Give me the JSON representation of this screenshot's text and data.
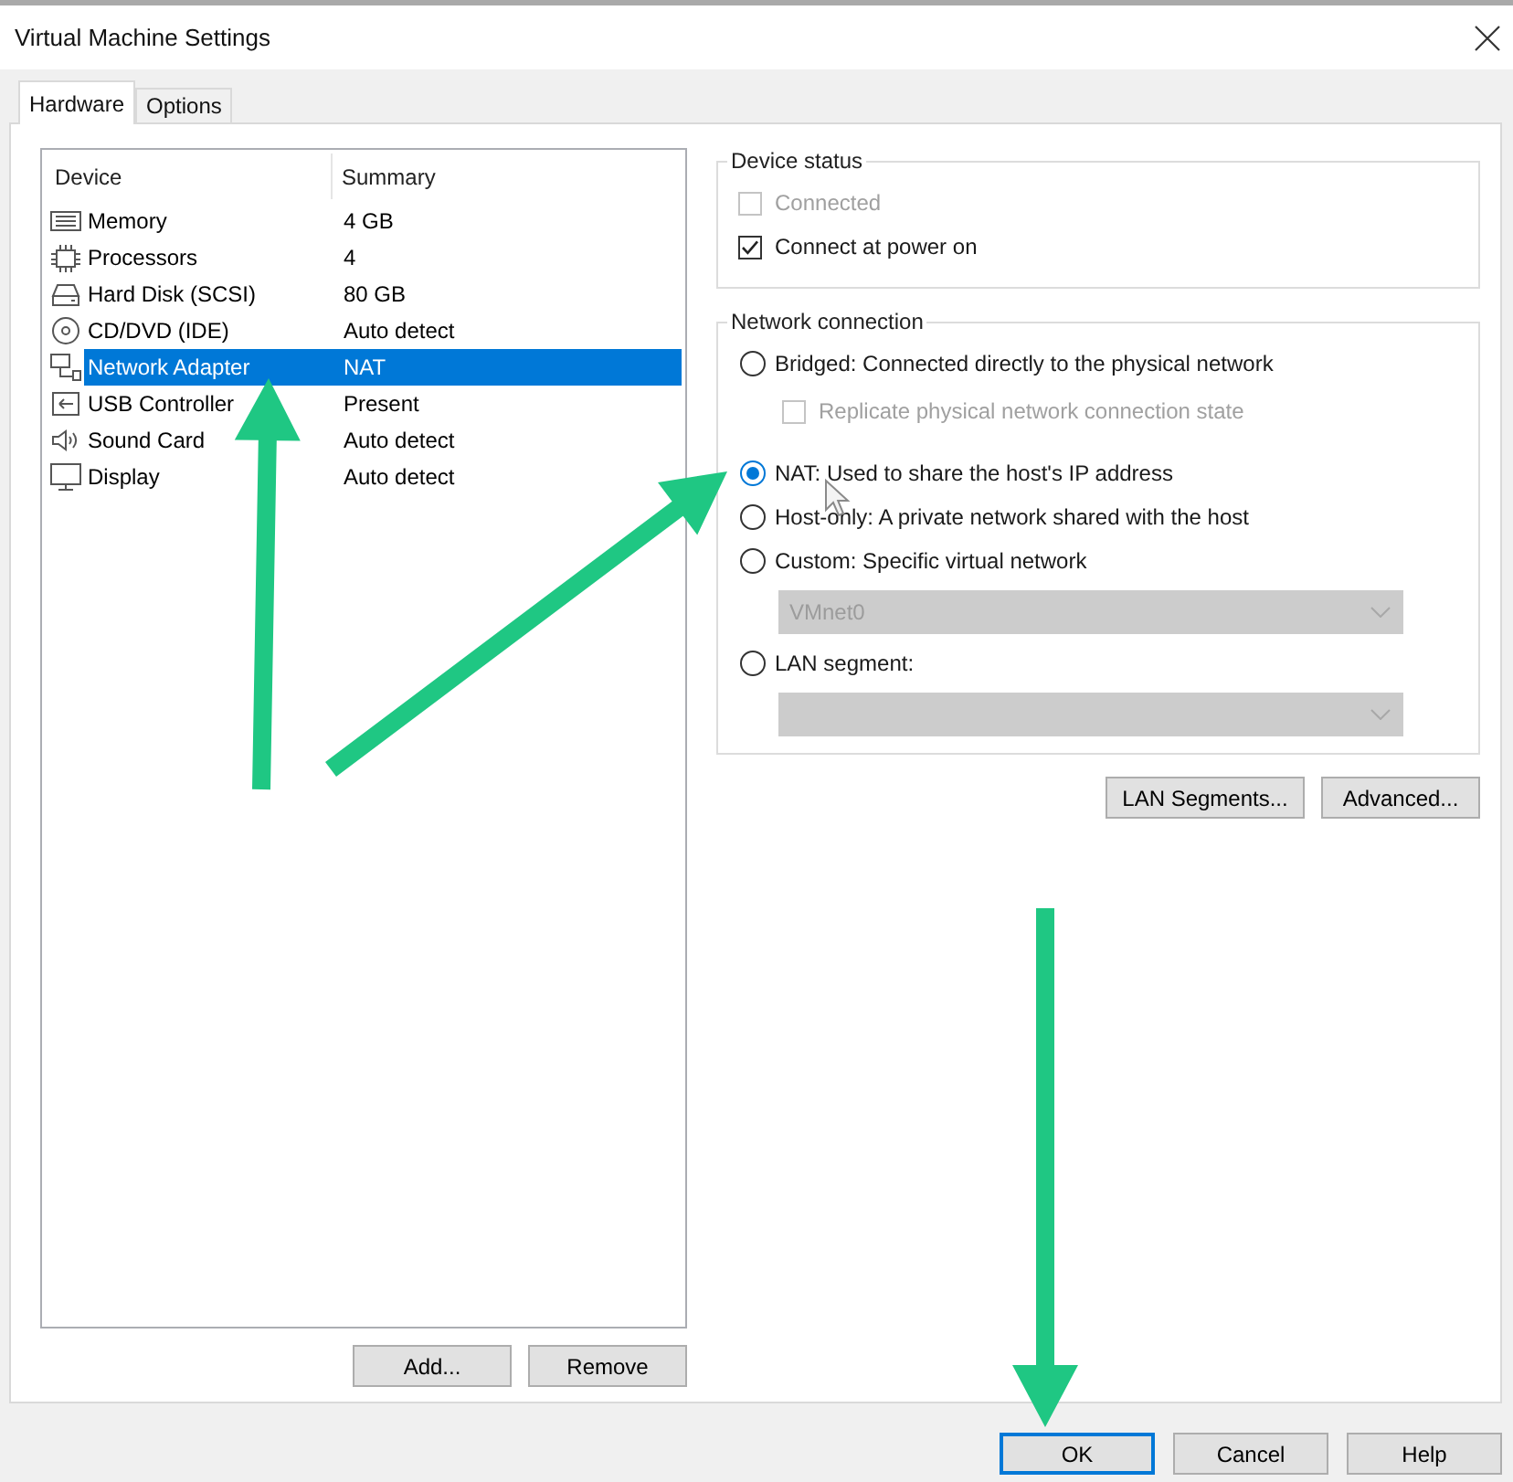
{
  "window": {
    "title": "Virtual Machine Settings"
  },
  "tabs": [
    {
      "label": "Hardware",
      "selected": true
    },
    {
      "label": "Options",
      "selected": false
    }
  ],
  "device_list": {
    "columns": [
      "Device",
      "Summary"
    ],
    "rows": [
      {
        "kind": "memory",
        "device": "Memory",
        "summary": "4 GB",
        "selected": false
      },
      {
        "kind": "processor",
        "device": "Processors",
        "summary": "4",
        "selected": false
      },
      {
        "kind": "hard_disk",
        "device": "Hard Disk (SCSI)",
        "summary": "80 GB",
        "selected": false
      },
      {
        "kind": "cd_dvd",
        "device": "CD/DVD (IDE)",
        "summary": "Auto detect",
        "selected": false
      },
      {
        "kind": "network",
        "device": "Network Adapter",
        "summary": "NAT",
        "selected": true
      },
      {
        "kind": "usb",
        "device": "USB Controller",
        "summary": "Present",
        "selected": false
      },
      {
        "kind": "sound",
        "device": "Sound Card",
        "summary": "Auto detect",
        "selected": false
      },
      {
        "kind": "display",
        "device": "Display",
        "summary": "Auto detect",
        "selected": false
      }
    ]
  },
  "device_buttons": [
    "Add...",
    "Remove"
  ],
  "device_status": {
    "title": "Device status",
    "options": [
      {
        "label": "Connected",
        "checked": false,
        "disabled": true
      },
      {
        "label": "Connect at power on",
        "checked": true,
        "disabled": false
      }
    ]
  },
  "network_connection": {
    "title": "Network connection",
    "items": [
      {
        "kind": "radio",
        "label": "Bridged: Connected directly to the physical network",
        "selected": false,
        "disabled": false
      },
      {
        "kind": "checkbox",
        "label": "Replicate physical network connection state",
        "checked": false,
        "disabled": true
      },
      {
        "kind": "radio",
        "label": "NAT: Used to share the host's IP address",
        "selected": true,
        "disabled": false
      },
      {
        "kind": "radio",
        "label": "Host-only: A private network shared with the host",
        "selected": false,
        "disabled": false
      },
      {
        "kind": "radio",
        "label": "Custom: Specific virtual network",
        "selected": false,
        "disabled": false
      },
      {
        "kind": "dropdown",
        "value": "VMnet0",
        "disabled": true
      },
      {
        "kind": "radio",
        "label": "LAN segment:",
        "selected": false,
        "disabled": false
      },
      {
        "kind": "dropdown",
        "disabled": true
      }
    ]
  },
  "network_buttons": [
    "LAN Segments...",
    "Advanced..."
  ],
  "dialog_buttons": [
    {
      "label": "OK",
      "default": true
    },
    {
      "label": "Cancel",
      "default": false
    },
    {
      "label": "Help",
      "default": false
    }
  ]
}
